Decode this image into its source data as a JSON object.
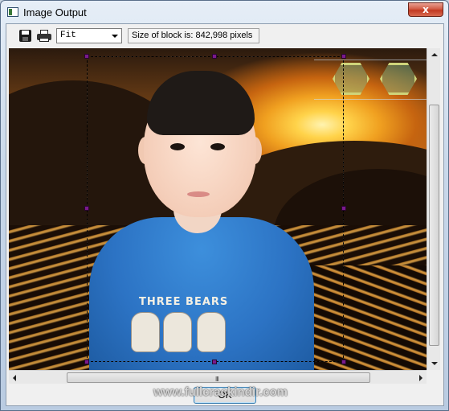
{
  "window": {
    "title": "Image Output",
    "close_label": "x"
  },
  "toolbar": {
    "save_icon": "save-icon",
    "print_icon": "print-icon",
    "zoom_value": "Fit",
    "block_size_text": "Size of block is: 842,998 pixels"
  },
  "image": {
    "shirt_print": "THREE BEARS"
  },
  "scrollbars": {
    "grip": "III"
  },
  "footer": {
    "ok_label": "OK",
    "watermark": "www.fullcrackindir.com"
  }
}
